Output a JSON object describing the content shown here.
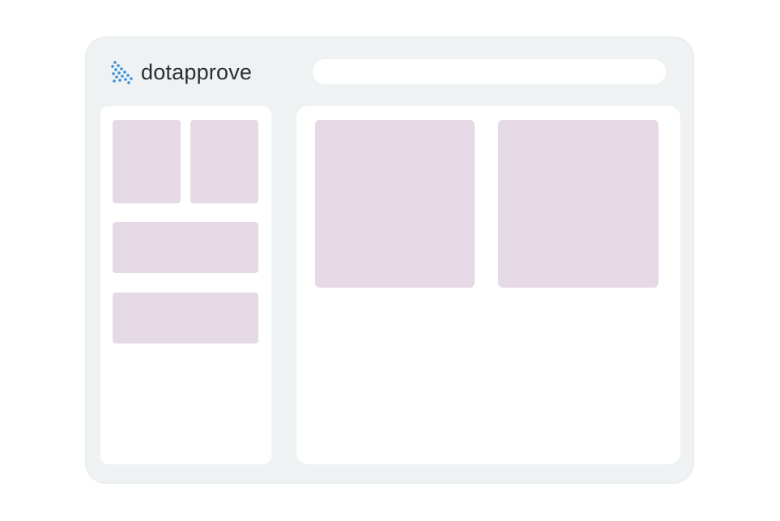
{
  "app": {
    "logo_text": "dotapprove",
    "logo_icon": "dotapprove-dots-icon",
    "brand_color": "#3a8fd6"
  },
  "search": {
    "placeholder": ""
  },
  "sidebar": {
    "tiles": [
      "placeholder-tile",
      "placeholder-tile"
    ],
    "wide_blocks": [
      "placeholder-block",
      "placeholder-block"
    ]
  },
  "main": {
    "cards": [
      "placeholder-card",
      "placeholder-card"
    ]
  },
  "colors": {
    "window_bg": "#eff2f3",
    "panel_bg": "#ffffff",
    "placeholder": "#e5d9e6"
  }
}
